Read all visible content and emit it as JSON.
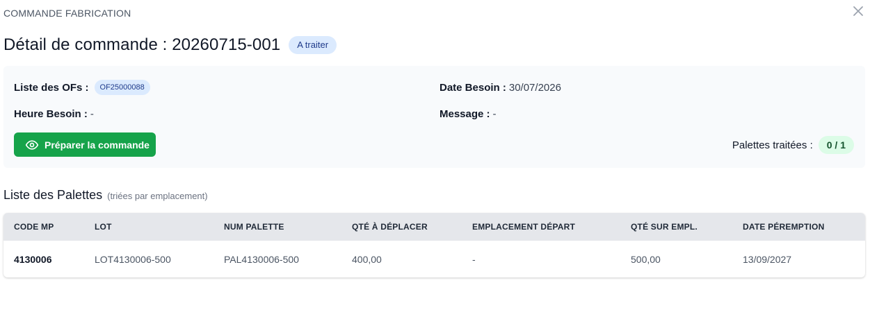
{
  "header": {
    "eyebrow": "COMMANDE FABRICATION",
    "title": "Détail de commande : 20260715-001",
    "status": "A traiter"
  },
  "details": {
    "ofs_label": "Liste des OFs :",
    "ofs": [
      "OF25000088"
    ],
    "date_label": "Date Besoin :",
    "date_value": "30/07/2026",
    "heure_label": "Heure Besoin :",
    "heure_value": "-",
    "message_label": "Message :",
    "message_value": "-",
    "prepare_button": "Préparer la commande",
    "palettes_label": "Palettes traitées :",
    "palettes_value": "0 / 1"
  },
  "palettes": {
    "title": "Liste des Palettes",
    "subtitle": "(triées par emplacement)",
    "columns": [
      "CODE MP",
      "LOT",
      "NUM PALETTE",
      "QTÉ À DÉPLACER",
      "EMPLACEMENT DÉPART",
      "QTÉ SUR EMPL.",
      "DATE PÉREMPTION"
    ],
    "rows": [
      [
        "4130006",
        "LOT4130006-500",
        "PAL4130006-500",
        "400,00",
        "-",
        "500,00",
        "13/09/2027"
      ]
    ]
  },
  "colors": {
    "primary_button": "#16a34a",
    "status_badge_bg": "#dbeafe",
    "counter_badge_bg": "#dcfce7"
  },
  "icons": {
    "close": "close-icon",
    "prepare": "eye-icon"
  }
}
